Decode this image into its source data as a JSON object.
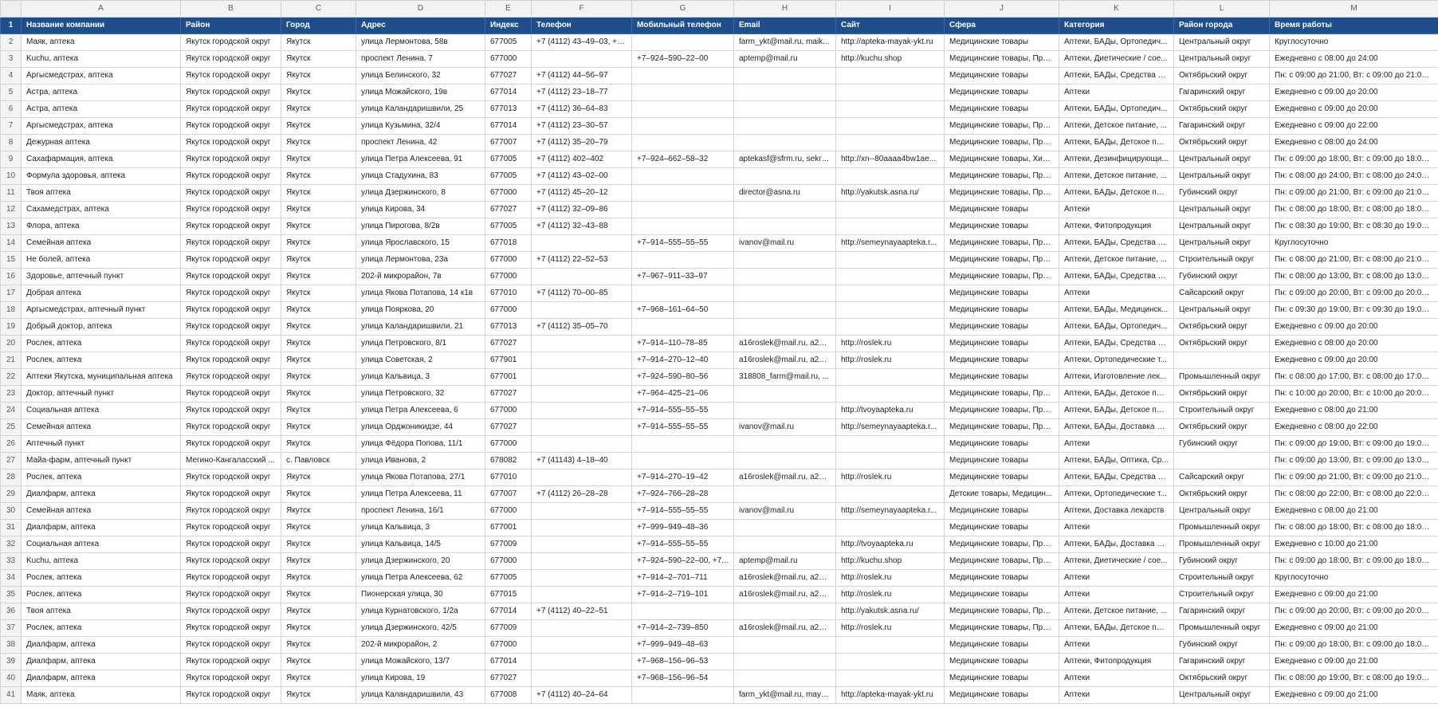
{
  "columns": [
    "A",
    "B",
    "C",
    "D",
    "E",
    "F",
    "G",
    "H",
    "I",
    "J",
    "K",
    "L",
    "M"
  ],
  "header_row_number": "1",
  "headers": [
    "Название компании",
    "Район",
    "Город",
    "Адрес",
    "Индекс",
    "Телефон",
    "Мобильный телефон",
    "Email",
    "Сайт",
    "Сфера",
    "Категория",
    "Район города",
    "Время работы"
  ],
  "rows": [
    [
      "2",
      "Маяк, аптека",
      "Якутск городской округ",
      "Якутск",
      "улица Лермонтова, 58в",
      "677005",
      "+7 (4112) 43–49–03, +7...",
      "",
      "farm_ykt@mail.ru, maik...",
      "http://apteka-mayak-ykt.ru",
      "Медицинские товары",
      "Аптеки, БАДы, Ортопедич...",
      "Центральный округ",
      "Круглосуточно"
    ],
    [
      "3",
      "Kuchu, аптека",
      "Якутск городской округ",
      "Якутск",
      "проспект Ленина, 7",
      "677000",
      "",
      "+7–924–590–22–00",
      "aptemp@mail.ru",
      "http://kuchu.shop",
      "Медицинские товары, Про...",
      "Аптеки, Диетические / сое...",
      "Центральный округ",
      "Ежедневно с 08:00 до 24:00"
    ],
    [
      "4",
      "Аргысмедстрах, аптека",
      "Якутск городской округ",
      "Якутск",
      "улица Белинского, 32",
      "677027",
      "+7 (4112) 44–56–97",
      "",
      "",
      "",
      "Медицинские товары",
      "Аптеки, БАДы, Средства ги...",
      "Октябрьский округ",
      "Пн: с 09:00 до 21:00, Вт: с 09:00 до 21:00, С..."
    ],
    [
      "5",
      "Астра, аптека",
      "Якутск городской округ",
      "Якутск",
      "улица Можайского, 19в",
      "677014",
      "+7 (4112) 23–18–77",
      "",
      "",
      "",
      "Медицинские товары",
      "Аптеки",
      "Гагаринский округ",
      "Ежедневно с 09:00 до 20:00"
    ],
    [
      "6",
      "Астра, аптека",
      "Якутск городской округ",
      "Якутск",
      "улица Каландаришвили, 25",
      "677013",
      "+7 (4112) 36–64–83",
      "",
      "",
      "",
      "Медицинские товары",
      "Аптеки, БАДы, Ортопедич...",
      "Октябрьский округ",
      "Ежедневно с 09:00 до 20:00"
    ],
    [
      "7",
      "Аргысмедстрах, аптека",
      "Якутск городской округ",
      "Якутск",
      "улица Кузьмина, 32/4",
      "677014",
      "+7 (4112) 23–30–57",
      "",
      "",
      "",
      "Медицинские товары, Про...",
      "Аптеки, Детское питание, ...",
      "Гагаринский округ",
      "Ежедневно с 09:00 до 22:00"
    ],
    [
      "8",
      "Дежурная аптека",
      "Якутск городской округ",
      "Якутск",
      "проспект Ленина, 42",
      "677007",
      "+7 (4112) 35–20–79",
      "",
      "",
      "",
      "Медицинские товары, Про...",
      "Аптеки, БАДы, Детское пит...",
      "Октябрьский округ",
      "Ежедневно с 08:00 до 24:00"
    ],
    [
      "9",
      "Сахафармация, аптека",
      "Якутск городской округ",
      "Якутск",
      "улица Петра Алексеева, 91",
      "677005",
      "+7 (4112) 402–402",
      "+7–924–662–58–32",
      "aptekasf@sfrm.ru, sekre...",
      "http://xn--80aaaa4bw1ae...",
      "Медицинские товары, Хим...",
      "Аптеки, Дезинфицирующи...",
      "Центральный округ",
      "Пн: с 09:00 до 18:00, Вт: с 09:00 до 18:00, С..."
    ],
    [
      "10",
      "Формула здоровья, аптека",
      "Якутск городской округ",
      "Якутск",
      "улица Стадухина, 83",
      "677005",
      "+7 (4112) 43–02–00",
      "",
      "",
      "",
      "Медицинские товары, Про...",
      "Аптеки, Детское питание, ...",
      "Центральный округ",
      "Пн: с 08:00 до 24:00, Вт: с 08:00 до 24:00, С..."
    ],
    [
      "11",
      "Твоя аптека",
      "Якутск городской округ",
      "Якутск",
      "улица Дзержинского, 8",
      "677000",
      "+7 (4112) 45–20–12",
      "",
      "director@asna.ru",
      "http://yakutsk.asna.ru/",
      "Медицинские товары, Про...",
      "Аптеки, БАДы, Детское пит...",
      "Губинский округ",
      "Пн: с 09:00 до 21:00, Вт: с 09:00 до 21:00, С..."
    ],
    [
      "12",
      "Сахамедстрах, аптека",
      "Якутск городской округ",
      "Якутск",
      "улица Кирова, 34",
      "677027",
      "+7 (4112) 32–09–86",
      "",
      "",
      "",
      "Медицинские товары",
      "Аптеки",
      "Центральный округ",
      "Пн: с 08:00 до 18:00, Вт: с 08:00 до 18:00, С..."
    ],
    [
      "13",
      "Флора, аптека",
      "Якутск городской округ",
      "Якутск",
      "улица Пирогова, 8/2в",
      "677005",
      "+7 (4112) 32–43–88",
      "",
      "",
      "",
      "Медицинские товары",
      "Аптеки, Фитопродукция",
      "Центральный округ",
      "Пн: с 08:30 до 19:00, Вт: с 08:30 до 19:00, С..."
    ],
    [
      "14",
      "Семейная аптека",
      "Якутск городской округ",
      "Якутск",
      "улица Ярославского, 15",
      "677018",
      "",
      "+7–914–555–55–55",
      "ivanov@mail.ru",
      "http://semeynayaapteka.r...",
      "Медицинские товары, Про...",
      "Аптеки, БАДы, Средства ги...",
      "Центральный округ",
      "Круглосуточно"
    ],
    [
      "15",
      "Не болей, аптека",
      "Якутск городской округ",
      "Якутск",
      "улица Лермонтова, 23а",
      "677000",
      "+7 (4112) 22–52–53",
      "",
      "",
      "",
      "Медицинские товары, Про...",
      "Аптеки, Детское питание, ...",
      "Строительный округ",
      "Пн: с 08:00 до 21:00, Вт: с 08:00 до 21:00, С..."
    ],
    [
      "16",
      "Здоровье, аптечный пункт",
      "Якутск городской округ",
      "Якутск",
      "202-й микрорайон, 7в",
      "677000",
      "",
      "+7–967–911–33–97",
      "",
      "",
      "Медицинские товары, Про...",
      "Аптеки, БАДы, Средства ги...",
      "Губинский округ",
      "Пн: с 08:00 до 13:00, Вт: с 08:00 до 13:00, С..."
    ],
    [
      "17",
      "Добрая аптека",
      "Якутск городской округ",
      "Якутск",
      "улица Якова Потапова, 14 к1в",
      "677010",
      "+7 (4112) 70–00–85",
      "",
      "",
      "",
      "Медицинские товары",
      "Аптеки",
      "Сайсарский округ",
      "Пн: с 09:00 до 20:00, Вт: с 09:00 до 20:00, С..."
    ],
    [
      "18",
      "Аргысмедстрах, аптечный пункт",
      "Якутск городской округ",
      "Якутск",
      "улица Пояркова, 20",
      "677000",
      "",
      "+7–968–161–64–50",
      "",
      "",
      "Медицинские товары",
      "Аптеки, БАДы, Медицинск...",
      "Центральный округ",
      "Пн: с 09:30 до 19:00, Вт: с 09:30 до 19:00, С..."
    ],
    [
      "19",
      "Добрый доктор, аптека",
      "Якутск городской округ",
      "Якутск",
      "улица Каландаришвили, 21",
      "677013",
      "+7 (4112) 35–05–70",
      "",
      "",
      "",
      "Медицинские товары",
      "Аптеки, БАДы, Ортопедич...",
      "Октябрьский округ",
      "Ежедневно с 09:00 до 20:00"
    ],
    [
      "20",
      "Рослек, аптека",
      "Якутск городской округ",
      "Якутск",
      "улица Петровского, 8/1",
      "677027",
      "",
      "+7–914–110–78–85",
      "a16roslek@mail.ru, a23r...",
      "http://roslek.ru",
      "Медицинские товары",
      "Аптеки, БАДы, Средства ги...",
      "Октябрьский округ",
      "Ежедневно с 08:00 до 20:00"
    ],
    [
      "21",
      "Рослек, аптека",
      "Якутск городской округ",
      "Якутск",
      "улица Советская, 2",
      "677901",
      "",
      "+7–914–270–12–40",
      "a16roslek@mail.ru, a23r...",
      "http://roslek.ru",
      "Медицинские товары",
      "Аптеки, Ортопедические т...",
      "",
      "Ежедневно с 09:00 до 20:00"
    ],
    [
      "22",
      "Аптеки Якутска, муниципальная аптека",
      "Якутск городской округ",
      "Якутск",
      "улица Кальвица, 3",
      "677001",
      "",
      "+7–924–590–80–56",
      "318808_farm@mail.ru, ...",
      "",
      "Медицинские товары",
      "Аптеки, Изготовление лек...",
      "Промышленный округ",
      "Пн: с 08:00 до 17:00, Вт: с 08:00 до 17:00, С..."
    ],
    [
      "23",
      "Доктор, аптечный пункт",
      "Якутск городской округ",
      "Якутск",
      "улица Петровского, 32",
      "677027",
      "",
      "+7–964–425–21–06",
      "",
      "",
      "Медицинские товары, Про...",
      "Аптеки, БАДы, Детское пит...",
      "Октябрьский округ",
      "Пн: с 10:00 до 20:00, Вт: с 10:00 до 20:00, С..."
    ],
    [
      "24",
      "Социальная аптека",
      "Якутск городской округ",
      "Якутск",
      "улица Петра Алексеева, 6",
      "677000",
      "",
      "+7–914–555–55–55",
      "",
      "http://tvoyaapteka.ru",
      "Медицинские товары, Про...",
      "Аптеки, БАДы, Детское пит...",
      "Строительный округ",
      "Ежедневно с 08:00 до 21:00"
    ],
    [
      "25",
      "Семейная аптека",
      "Якутск городской округ",
      "Якутск",
      "улица Орджоникидзе, 44",
      "677027",
      "",
      "+7–914–555–55–55",
      "ivanov@mail.ru",
      "http://semeynayaapteka.r...",
      "Медицинские товары, Про...",
      "Аптеки, БАДы, Доставка ле...",
      "Октябрьский округ",
      "Ежедневно с 08:00 до 22:00"
    ],
    [
      "26",
      "Аптечный пункт",
      "Якутск городской округ",
      "Якутск",
      "улица Фёдора Попова, 11/1",
      "677000",
      "",
      "",
      "",
      "",
      "Медицинские товары",
      "Аптеки",
      "Губинский округ",
      "Пн: с 09:00 до 19:00, Вт: с 09:00 до 19:00, С..."
    ],
    [
      "27",
      "Майа-фарм, аптечный пункт",
      "Мегино-Кангаласский ...",
      "с. Павловск",
      "улица Иванова, 2",
      "678082",
      "+7 (41143) 4–18–40",
      "",
      "",
      "",
      "Медицинские товары",
      "Аптеки, БАДы, Оптика, Ср...",
      "",
      "Пн: с 09:00 до 13:00, Вт: с 09:00 до 13:00, С..."
    ],
    [
      "28",
      "Рослек, аптека",
      "Якутск городской округ",
      "Якутск",
      "улица Якова Потапова, 27/1",
      "677010",
      "",
      "+7–914–270–19–42",
      "a16roslek@mail.ru, a23r...",
      "http://roslek.ru",
      "Медицинские товары",
      "Аптеки, БАДы, Средства ги...",
      "Сайсарский округ",
      "Пн: с 09:00 до 21:00, Вт: с 09:00 до 21:00, С..."
    ],
    [
      "29",
      "Диалфарм, аптека",
      "Якутск городской округ",
      "Якутск",
      "улица Петра Алексеева, 11",
      "677007",
      "+7 (4112) 26–28–28",
      "+7–924–766–28–28",
      "",
      "",
      "Детские товары, Медицин...",
      "Аптеки, Ортопедические т...",
      "Октябрьский округ",
      "Пн: с 08:00 до 22:00, Вт: с 08:00 до 22:00, С..."
    ],
    [
      "30",
      "Семейная аптека",
      "Якутск городской округ",
      "Якутск",
      "проспект Ленина, 16/1",
      "677000",
      "",
      "+7–914–555–55–55",
      "ivanov@mail.ru",
      "http://semeynayaapteka.r...",
      "Медицинские товары",
      "Аптеки, Доставка лекарств",
      "Центральный округ",
      "Ежедневно с 08:00 до 21:00"
    ],
    [
      "31",
      "Диалфарм, аптека",
      "Якутск городской округ",
      "Якутск",
      "улица Кальвица, 3",
      "677001",
      "",
      "+7–999–949–48–36",
      "",
      "",
      "Медицинские товары",
      "Аптеки",
      "Промышленный округ",
      "Пн: с 08:00 до 18:00, Вт: с 08:00 до 18:00, С..."
    ],
    [
      "32",
      "Социальная аптека",
      "Якутск городской округ",
      "Якутск",
      "улица Кальвица, 14/5",
      "677009",
      "",
      "+7–914–555–55–55",
      "",
      "http://tvoyaapteka.ru",
      "Медицинские товары, Про...",
      "Аптеки, БАДы, Доставка ле...",
      "Промышленный округ",
      "Ежедневно с 10:00 до 21:00"
    ],
    [
      "33",
      "Kuchu, аптека",
      "Якутск городской округ",
      "Якутск",
      "улица Дзержинского, 20",
      "677000",
      "",
      "+7–924–590–22–00, +7...",
      "aptemp@mail.ru",
      "http://kuchu.shop",
      "Медицинские товары, Про...",
      "Аптеки, Диетические / сое...",
      "Губинский округ",
      "Пн: с 09:00 до 18:00, Вт: с 09:00 до 18:00, С..."
    ],
    [
      "34",
      "Рослек, аптека",
      "Якутск городской округ",
      "Якутск",
      "улица Петра Алексеева, 62",
      "677005",
      "",
      "+7–914–2–701–711",
      "a16roslek@mail.ru, a23r...",
      "http://roslek.ru",
      "Медицинские товары",
      "Аптеки",
      "Строительный округ",
      "Круглосуточно"
    ],
    [
      "35",
      "Рослек, аптека",
      "Якутск городской округ",
      "Якутск",
      "Пионерская улица, 30",
      "677015",
      "",
      "+7–914–2–719–101",
      "a16roslek@mail.ru, a23r...",
      "http://roslek.ru",
      "Медицинские товары",
      "Аптеки",
      "Строительный округ",
      "Ежедневно с 09:00 до 21:00"
    ],
    [
      "36",
      "Твоя аптека",
      "Якутск городской округ",
      "Якутск",
      "улица Курнатовского, 1/2а",
      "677014",
      "+7 (4112) 40–22–51",
      "",
      "",
      "http://yakutsk.asna.ru/",
      "Медицинские товары, Про...",
      "Аптеки, Детское питание, ...",
      "Гагаринский округ",
      "Пн: с 09:00 до 20:00, Вт: с 09:00 до 20:00, С..."
    ],
    [
      "37",
      "Рослек, аптека",
      "Якутск городской округ",
      "Якутск",
      "улица Дзержинского, 42/5",
      "677009",
      "",
      "+7–914–2–739–850",
      "a16roslek@mail.ru, a23r...",
      "http://roslek.ru",
      "Медицинские товары, Про...",
      "Аптеки, БАДы, Детское пит...",
      "Промышленный округ",
      "Ежедневно с 09:00 до 21:00"
    ],
    [
      "38",
      "Диалфарм, аптека",
      "Якутск городской округ",
      "Якутск",
      "202-й микрорайон, 2",
      "677000",
      "",
      "+7–999–949–48–63",
      "",
      "",
      "Медицинские товары",
      "Аптеки",
      "Губинский округ",
      "Пн: с 09:00 до 18:00, Вт: с 09:00 до 18:00, С..."
    ],
    [
      "39",
      "Диалфарм, аптека",
      "Якутск городской округ",
      "Якутск",
      "улица Можайского, 13/7",
      "677014",
      "",
      "+7–968–156–96–53",
      "",
      "",
      "Медицинские товары",
      "Аптеки, Фитопродукция",
      "Гагаринский округ",
      "Ежедневно с 09:00 до 21:00"
    ],
    [
      "40",
      "Диалфарм, аптека",
      "Якутск городской округ",
      "Якутск",
      "улица Кирова, 19",
      "677027",
      "",
      "+7–968–156–96–54",
      "",
      "",
      "Медицинские товары",
      "Аптеки",
      "Октябрьский округ",
      "Пн: с 08:00 до 19:00, Вт: с 08:00 до 19:00, С..."
    ],
    [
      "41",
      "Маяк, аптека",
      "Якутск городской округ",
      "Якутск",
      "улица Каландаришвили, 43",
      "677008",
      "+7 (4112) 40–24–64",
      "",
      "farm_ykt@mail.ru, maya...",
      "http://apteka-mayak-ykt.ru",
      "Медицинские товары",
      "Аптеки",
      "Центральный округ",
      "Ежедневно с 09:00 до 21:00"
    ]
  ]
}
